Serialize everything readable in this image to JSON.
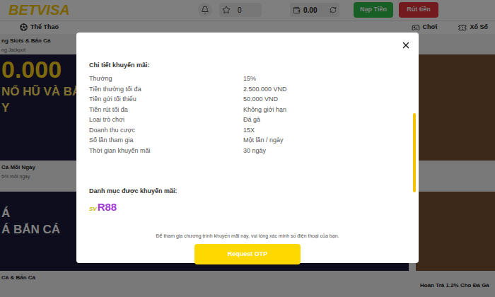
{
  "header": {
    "logo": "BETVISA",
    "favorites_count": "0",
    "balance": "0.00",
    "buttons": [
      {
        "label": "Nạp Tiền",
        "kind": "deposit"
      },
      {
        "label": "Rút tiền",
        "kind": "withdraw"
      }
    ]
  },
  "nav": [
    {
      "label": "Thể Thao",
      "kind": "sports"
    },
    {
      "label": "Chơi",
      "kind": "games"
    },
    {
      "label": "Xổ Số",
      "kind": "lottery"
    }
  ],
  "feed": [
    {
      "kind": "caption",
      "left": {
        "title": "ng Slots & Bắn Cá",
        "subtitle": "ng Jackpot"
      }
    },
    {
      "kind": "banner",
      "left": {
        "lines": [
          "0.000",
          "NỔ HŨ VÀ BẮN",
          "Y"
        ]
      }
    },
    {
      "kind": "caption",
      "left": {
        "title": "Cá Mỗi Ngày",
        "subtitle": "5% mỗi ngày"
      }
    },
    {
      "kind": "banner",
      "left": {
        "lines": [
          "Á",
          "Á BẮN CÁ"
        ]
      }
    },
    {
      "kind": "caption",
      "left": {
        "title": "Cá & Bắn Cá"
      },
      "right": {
        "title": "Hoàn Trả 1.2% Cho Đá Gà"
      }
    }
  ],
  "modal": {
    "title": "Chi tiết khuyến mãi:",
    "details": [
      {
        "label": "Thưởng",
        "value": "15%"
      },
      {
        "label": "Tiền thưởng tối đa",
        "value": "2.500.000 VND"
      },
      {
        "label": "Tiền gửi tối thiểu",
        "value": "50.000 VND"
      },
      {
        "label": "Tiền rút tối đa",
        "value": "Không giới hạn"
      },
      {
        "label": "Loại trò chơi",
        "value": "Đá gà"
      },
      {
        "label": "Doanh thu cược",
        "value": "15X"
      },
      {
        "label": "Số lần tham gia",
        "value": "Một lần / ngày"
      },
      {
        "label": "Thời gian khuyến mãi",
        "value": "30 ngày"
      }
    ],
    "category_title": "Danh mục được khuyến mãi:",
    "category_logo": {
      "prefix": "SV",
      "name": "R88"
    },
    "note": "Để tham gia chương trình khuyến mãi này, vui lòng xác minh số điện thoại của bạn.",
    "button": "Request OTP"
  }
}
